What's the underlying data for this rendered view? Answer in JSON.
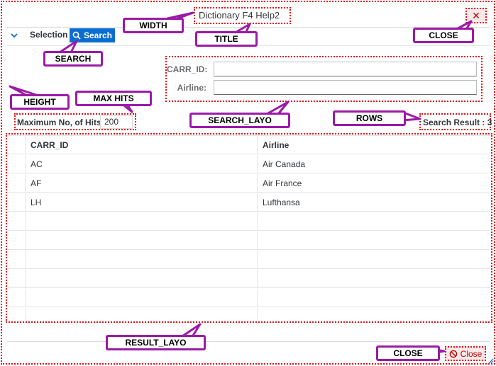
{
  "dialog": {
    "title": "Dictionary F4 Help2",
    "close_icon": "✕"
  },
  "toolbar": {
    "selection_label": "Selection",
    "search_button": "Search"
  },
  "search_fields": [
    {
      "label": "CARR_ID:",
      "value": ""
    },
    {
      "label": "Airline:",
      "value": ""
    }
  ],
  "max_hits": {
    "label": "Maximum No, of Hits",
    "value": "200"
  },
  "rows": {
    "text": "Search Result : 3"
  },
  "table": {
    "columns": [
      "CARR_ID",
      "Airline"
    ],
    "rows": [
      [
        "AC",
        "Air Canada"
      ],
      [
        "AF",
        "Air France"
      ],
      [
        "LH",
        "Lufthansa"
      ]
    ],
    "empty_rows": 6
  },
  "footer": {
    "close_button": "Close"
  },
  "callouts": {
    "width": "WIDTH",
    "title": "TITLE",
    "close_top": "CLOSE",
    "search": "SEARCH",
    "height": "HEIGHT",
    "max_hits": "MAX HITS",
    "search_layo": "SEARCH_LAYO",
    "rows": "ROWS",
    "result_layo": "RESULT_LAYO",
    "close_bottom": "CLOSE"
  },
  "colors": {
    "accent": "#0a6ed1",
    "annotation_red": "#e0101a",
    "annotation_purple": "#9b1aa8",
    "reject": "#bb0000"
  }
}
